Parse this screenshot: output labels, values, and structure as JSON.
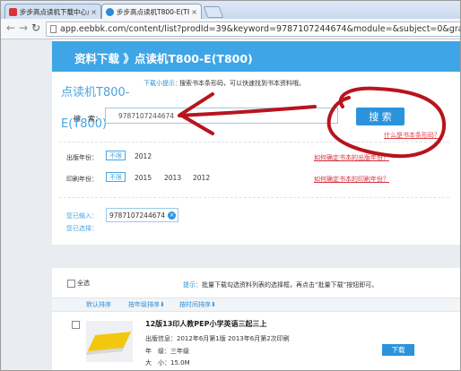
{
  "browser": {
    "tabs": [
      {
        "title": "步步高点读机下载中心点",
        "active": false
      },
      {
        "title": "步步高点读机T800-E(T8",
        "active": true
      }
    ],
    "url": "app.eebbk.com/content/list?prodId=39&keyword=9787107244674&module=&subject=0&grade="
  },
  "banner": "资料下载 》点读机T800-E(T800)",
  "product_title": "点读机T800-E(T800)",
  "tip": {
    "label": "下载小提示：",
    "text": "搜索书本条形码，可以快速找到书本资料哦。"
  },
  "search": {
    "label": "搜　索：",
    "value": "9787107244674",
    "button": "搜 索",
    "what_link": "什么是书本条形码？"
  },
  "filters": {
    "publish_year": {
      "label": "出版年份：",
      "unlimited": "不限",
      "values": [
        "2012"
      ],
      "help": "如何确定书本的出版年份？"
    },
    "print_year": {
      "label": "印刷年份：",
      "unlimited": "不限",
      "values": [
        "2015",
        "2013",
        "2012"
      ],
      "help": "如何确定书本的印刷年份？"
    }
  },
  "entered": {
    "label": "您已输入：",
    "value": "9787107244674",
    "remove": "×"
  },
  "selected": {
    "label": "您已选择："
  },
  "results": {
    "select_all": "全选",
    "hint_prefix": "提示：",
    "hint": "批量下载勾选资料列表的选择框，再点击“批量下载”按钮即可。",
    "sort": [
      "默认排序",
      "按年级排序",
      "按时间排序"
    ],
    "items": [
      {
        "title": "12版13印人教PEP小学英语三起三上",
        "publish_info": "出版信息：2012年6月第1版 2013年6月第2次印刷",
        "grade": "年　级：三年级",
        "size": "大　小：15.0M",
        "download": "下载"
      }
    ]
  },
  "colors": {
    "accent": "#3ea5e6",
    "button": "#2b93dc",
    "annotation": "#b8141c",
    "link_red": "#d2343f"
  }
}
